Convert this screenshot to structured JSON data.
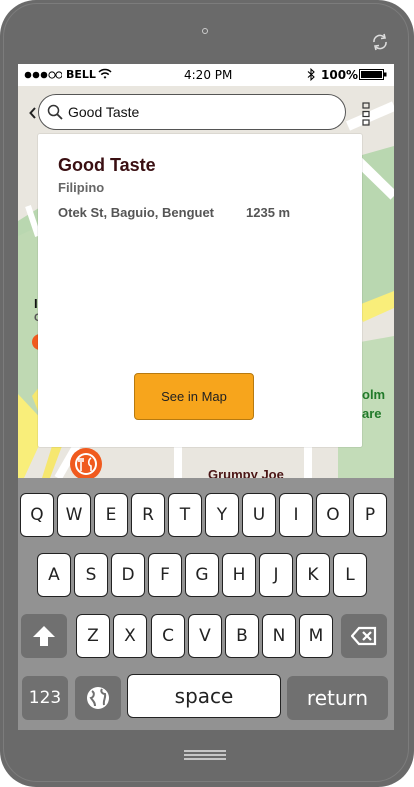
{
  "status_bar": {
    "carrier": "BELL",
    "time": "4:20 PM",
    "battery": "100%"
  },
  "search": {
    "value": "Good Taste"
  },
  "result": {
    "name": "Good Taste",
    "cuisine": "Filipino",
    "address": "Otek St, Baguio, Benguet",
    "distance": "1235 m",
    "action_label": "See in Map"
  },
  "map": {
    "label_poi": "Grumpy Joe",
    "label_park_line1": "olm",
    "label_park_line2": "are",
    "label_left_1": "I",
    "label_left_2": "C"
  },
  "keyboard": {
    "row1": [
      "Q",
      "W",
      "E",
      "R",
      "T",
      "Y",
      "U",
      "I",
      "O",
      "P"
    ],
    "row2": [
      "A",
      "S",
      "D",
      "F",
      "G",
      "H",
      "J",
      "K",
      "L"
    ],
    "row3": [
      "Z",
      "X",
      "C",
      "V",
      "B",
      "N",
      "M"
    ],
    "numbers_label": "123",
    "space_label": "space",
    "return_label": "return"
  },
  "icons": {
    "search": "search-icon",
    "menu": "vertical-dots-icon",
    "back": "chevron-left-icon",
    "shift": "shift-arrow-icon",
    "backspace": "backspace-icon",
    "globe": "globe-icon",
    "restaurant_marker": "fork-knife-icon",
    "rotate": "rotate-icon",
    "home": "home-button-icon"
  },
  "colors": {
    "accent": "#f7a51c",
    "title": "#3a0f12",
    "park_green": "#b9d7b0",
    "road_yellow": "#f9ee7a",
    "marker_orange": "#f05a1e"
  }
}
